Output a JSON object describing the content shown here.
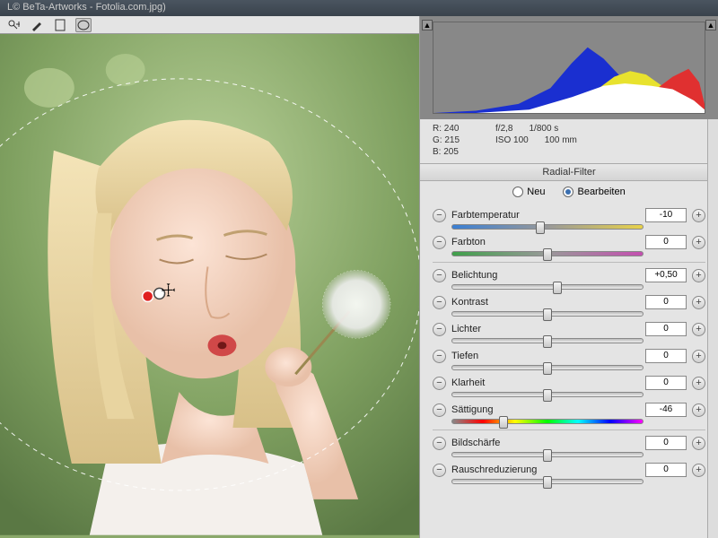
{
  "window_title": "L© BeTa-Artworks - Fotolia.com.jpg)",
  "info": {
    "r": "R:   240",
    "g": "G:   215",
    "b": "B:   205",
    "aperture": "f/2,8",
    "shutter": "1/800 s",
    "iso": "ISO 100",
    "focal": "100 mm"
  },
  "panel_title": "Radial-Filter",
  "mode": {
    "new_label": "Neu",
    "edit_label": "Bearbeiten",
    "selected": "edit"
  },
  "sliders": {
    "temp": {
      "label": "Farbtemperatur",
      "value": "-10",
      "pos": 46
    },
    "tint": {
      "label": "Farbton",
      "value": "0",
      "pos": 50
    },
    "exposure": {
      "label": "Belichtung",
      "value": "+0,50",
      "pos": 55
    },
    "contrast": {
      "label": "Kontrast",
      "value": "0",
      "pos": 50
    },
    "highlights": {
      "label": "Lichter",
      "value": "0",
      "pos": 50
    },
    "shadows": {
      "label": "Tiefen",
      "value": "0",
      "pos": 50
    },
    "clarity": {
      "label": "Klarheit",
      "value": "0",
      "pos": 50
    },
    "saturation": {
      "label": "Sättigung",
      "value": "-46",
      "pos": 27
    },
    "sharpness": {
      "label": "Bildschärfe",
      "value": "0",
      "pos": 50
    },
    "noise": {
      "label": "Rauschreduzierung",
      "value": "0",
      "pos": 50
    }
  },
  "chart_data": {
    "type": "area",
    "title": "RGB Histogram",
    "xlabel": "",
    "ylabel": "",
    "x_range": [
      0,
      255
    ],
    "series": [
      {
        "name": "blue",
        "color": "#1a2fd0",
        "points": [
          [
            0,
            0
          ],
          [
            40,
            2
          ],
          [
            80,
            8
          ],
          [
            110,
            28
          ],
          [
            130,
            55
          ],
          [
            145,
            72
          ],
          [
            160,
            60
          ],
          [
            180,
            35
          ],
          [
            200,
            12
          ],
          [
            220,
            4
          ],
          [
            255,
            0
          ]
        ]
      },
      {
        "name": "green",
        "color": "#e8e22e",
        "points": [
          [
            80,
            0
          ],
          [
            120,
            6
          ],
          [
            150,
            22
          ],
          [
            170,
            40
          ],
          [
            185,
            46
          ],
          [
            200,
            42
          ],
          [
            215,
            30
          ],
          [
            230,
            14
          ],
          [
            245,
            4
          ],
          [
            255,
            0
          ]
        ]
      },
      {
        "name": "red",
        "color": "#e03030",
        "points": [
          [
            150,
            0
          ],
          [
            180,
            6
          ],
          [
            205,
            22
          ],
          [
            225,
            40
          ],
          [
            240,
            48
          ],
          [
            250,
            34
          ],
          [
            255,
            10
          ]
        ]
      },
      {
        "name": "luma",
        "color": "#ffffff",
        "points": [
          [
            40,
            0
          ],
          [
            90,
            4
          ],
          [
            130,
            18
          ],
          [
            160,
            30
          ],
          [
            180,
            32
          ],
          [
            205,
            30
          ],
          [
            225,
            26
          ],
          [
            245,
            14
          ],
          [
            255,
            4
          ]
        ]
      }
    ]
  }
}
